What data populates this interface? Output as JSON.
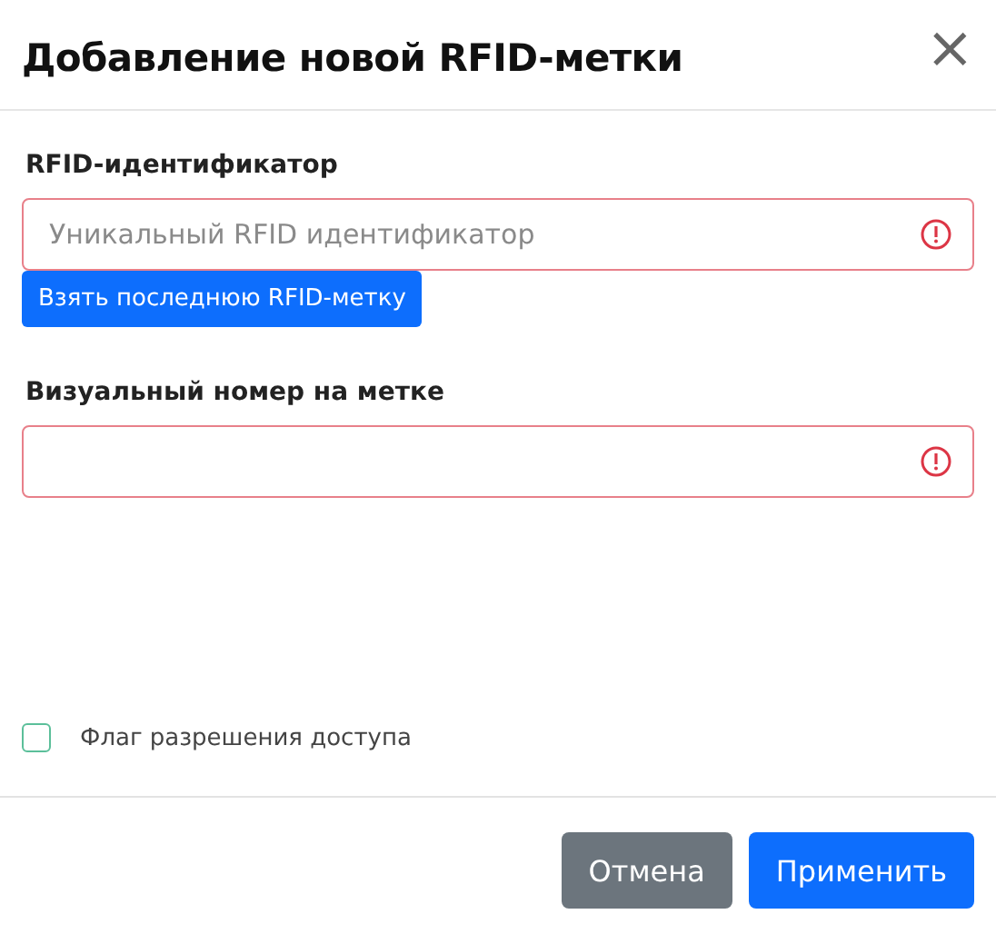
{
  "dialog": {
    "title": "Добавление новой RFID-метки",
    "close_label": "×"
  },
  "fields": [
    {
      "label": "RFID-идентификатор",
      "placeholder": "Уникальный RFID идентификатор",
      "invalid": true,
      "action": "Взять последнюю RFID-метку"
    },
    {
      "label": "Визуальный номер на метке",
      "invalid": true
    }
  ],
  "checkbox": {
    "label": "Флаг разрешения доступа",
    "checked": false
  },
  "buttons": [
    {
      "label": "Отмена",
      "kind": "secondary"
    },
    {
      "label": "Применить",
      "kind": "primary"
    }
  ]
}
